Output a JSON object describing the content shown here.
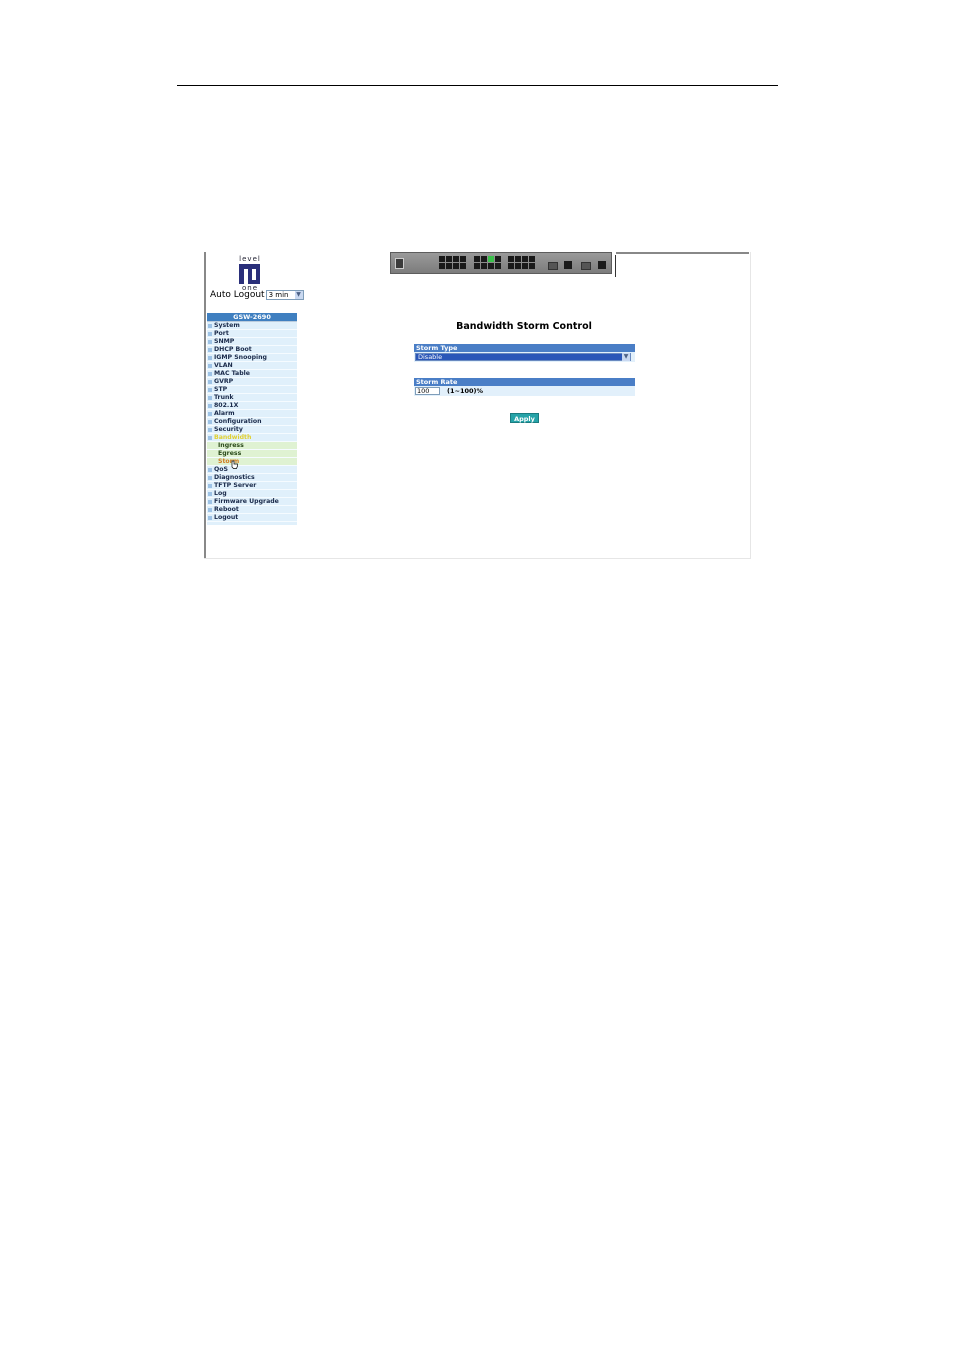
{
  "logo": {
    "top_text": "level",
    "bottom_text": "one"
  },
  "auto_logout": {
    "label": "Auto Logout",
    "value": "3 min"
  },
  "menu": {
    "header": "GSW-2690",
    "items": [
      {
        "label": "System"
      },
      {
        "label": "Port"
      },
      {
        "label": "SNMP"
      },
      {
        "label": "DHCP Boot"
      },
      {
        "label": "IGMP Snooping"
      },
      {
        "label": "VLAN"
      },
      {
        "label": "MAC Table"
      },
      {
        "label": "GVRP"
      },
      {
        "label": "STP"
      },
      {
        "label": "Trunk"
      },
      {
        "label": "802.1X"
      },
      {
        "label": "Alarm"
      },
      {
        "label": "Configuration"
      },
      {
        "label": "Security"
      },
      {
        "label": "Bandwidth"
      },
      {
        "label": "Ingress"
      },
      {
        "label": "Egress"
      },
      {
        "label": "Storm"
      },
      {
        "label": "QoS"
      },
      {
        "label": "Diagnostics"
      },
      {
        "label": "TFTP Server"
      },
      {
        "label": "Log"
      },
      {
        "label": "Firmware Upgrade"
      },
      {
        "label": "Reboot"
      },
      {
        "label": "Logout"
      }
    ]
  },
  "main": {
    "title": "Bandwidth Storm Control",
    "storm_type": {
      "label": "Storm Type",
      "value": "Disable"
    },
    "storm_rate": {
      "label": "Storm Rate",
      "value": "100",
      "range": "(1~100)%"
    },
    "apply_label": "Apply"
  },
  "colors": {
    "menu_header": "#3f7fc0",
    "menu_bg": "#e0f0fb",
    "active_item": "#e0d030",
    "panel_head": "#4a7ec6",
    "apply_button": "#26a3a8"
  }
}
